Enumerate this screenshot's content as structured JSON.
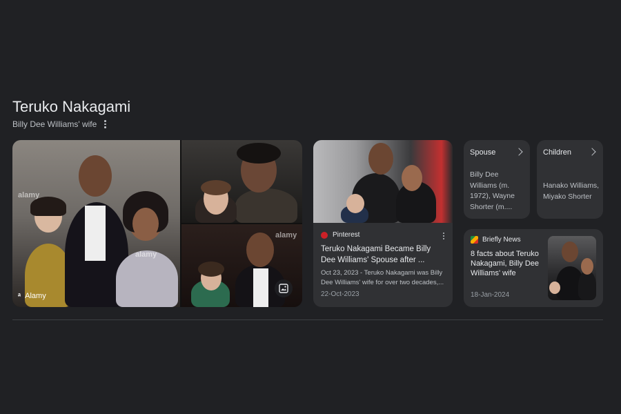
{
  "header": {
    "title": "Teruko Nakagami",
    "subtitle": "Billy Dee Williams' wife"
  },
  "image_collage": {
    "watermark": "alamy",
    "source_label": "Alamy"
  },
  "pinterest_card": {
    "source": "Pinterest",
    "title": "Teruko Nakagami Became Billy Dee Williams' Spouse after ...",
    "snippet": "Oct 23, 2023 - Teruko Nakagami was Billy Dee Williams' wife for over two decades,...",
    "date": "22-Oct-2023"
  },
  "facts": [
    {
      "label": "Spouse",
      "value": "Billy Dee Williams (m. 1972), Wayne Shorter (m...."
    },
    {
      "label": "Children",
      "value": "Hanako Williams, Miyako Shorter"
    }
  ],
  "briefly_card": {
    "source": "Briefly News",
    "title": "8 facts about Teruko Nakagami, Billy Dee Williams' wife",
    "date": "18-Jan-2024"
  },
  "icons": {
    "more": "more-vert-icon",
    "chevron": "chevron-right-icon",
    "image_search": "image-search-icon"
  }
}
